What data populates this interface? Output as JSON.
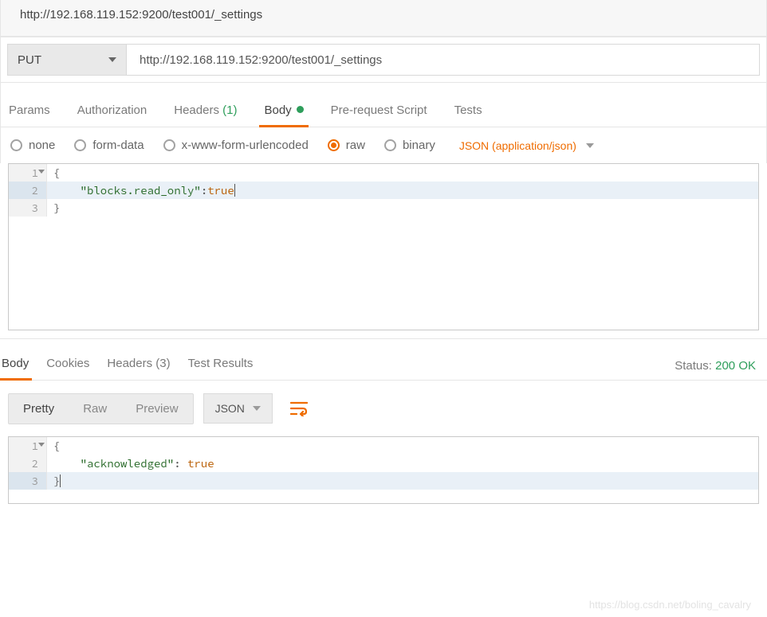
{
  "request_title": "http://192.168.119.152:9200/test001/_settings",
  "method": "PUT",
  "url_value": "http://192.168.119.152:9200/test001/_settings",
  "tabs": {
    "params": "Params",
    "authorization": "Authorization",
    "headers": "Headers",
    "headers_count": "(1)",
    "body": "Body",
    "prerequest": "Pre-request Script",
    "tests": "Tests"
  },
  "body_types": {
    "none": "none",
    "formdata": "form-data",
    "urlencoded": "x-www-form-urlencoded",
    "raw": "raw",
    "binary": "binary"
  },
  "content_type": "JSON (application/json)",
  "request_body": {
    "line1": "{",
    "line2_key": "\"blocks.read_only\"",
    "line2_sep": ":",
    "line2_val": "true",
    "line3": "}"
  },
  "resp_tabs": {
    "body": "Body",
    "cookies": "Cookies",
    "headers": "Headers",
    "headers_count": "(3)",
    "tests": "Test Results"
  },
  "status_label": "Status:",
  "status_value": "200 OK",
  "view_modes": {
    "pretty": "Pretty",
    "raw": "Raw",
    "preview": "Preview"
  },
  "format_select": "JSON",
  "response_body": {
    "line1": "{",
    "line2_key": "\"acknowledged\"",
    "line2_sep": ": ",
    "line2_val": "true",
    "line3": "}"
  },
  "watermark": "https://blog.csdn.net/boling_cavalry"
}
